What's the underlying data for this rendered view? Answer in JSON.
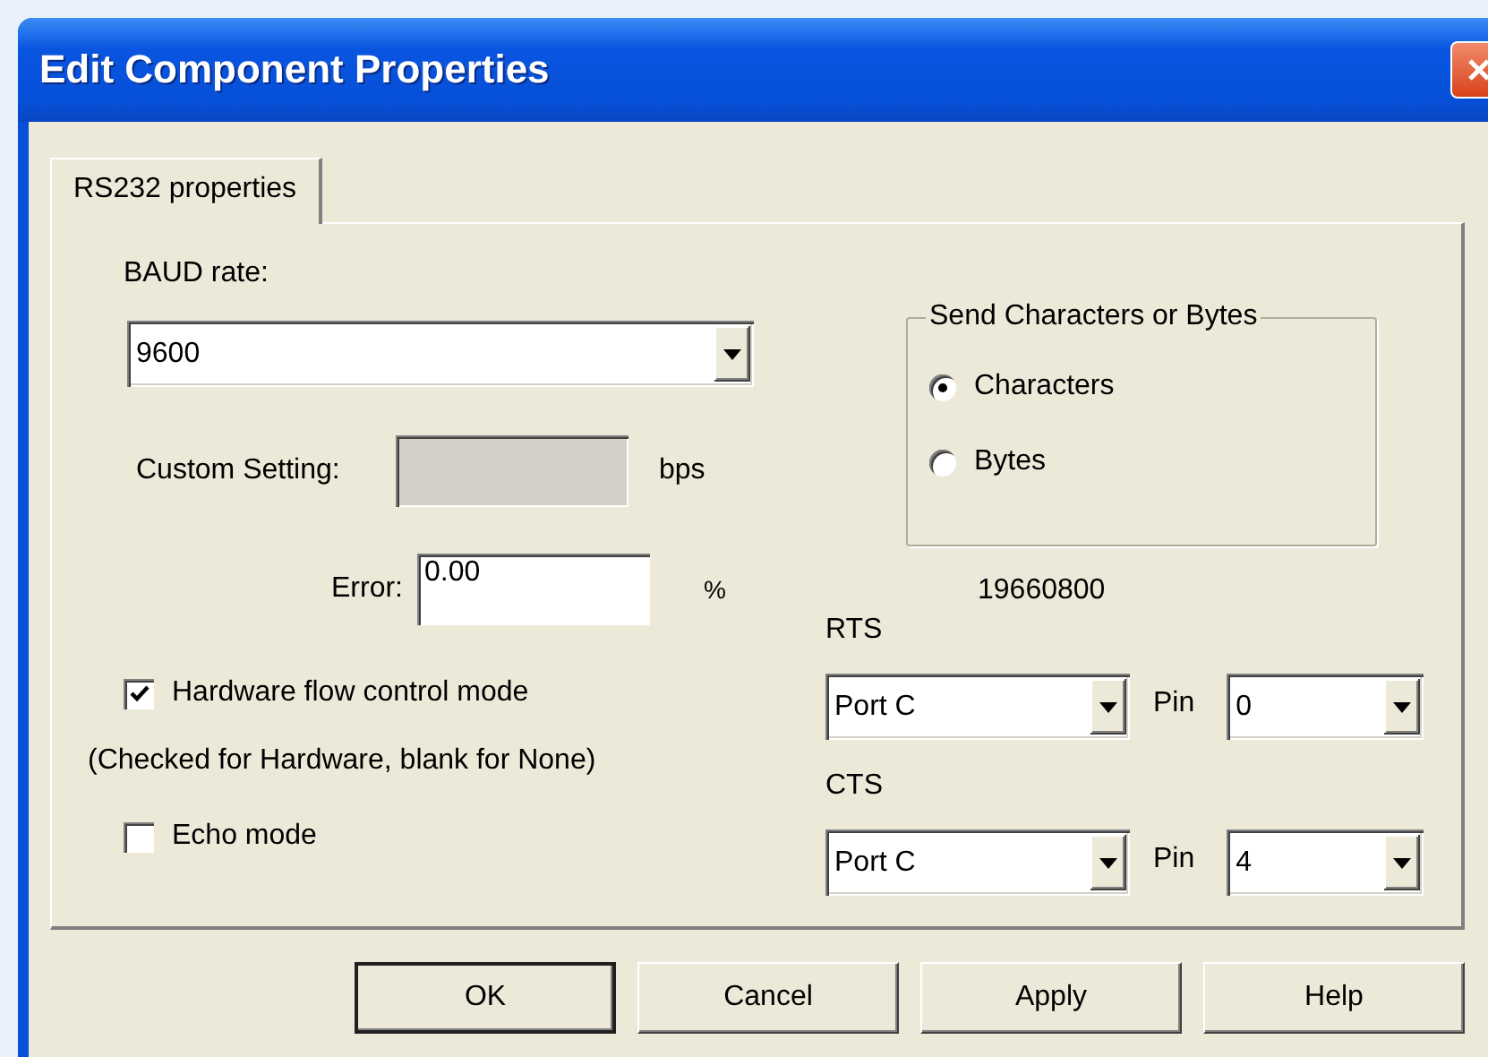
{
  "window": {
    "title": "Edit Component Properties"
  },
  "tabs": [
    {
      "label": "RS232 properties",
      "selected": true
    }
  ],
  "baud_rate": {
    "label": "BAUD rate:",
    "value": "9600"
  },
  "custom_setting": {
    "label": "Custom Setting:",
    "unit": "bps",
    "disabled": true
  },
  "error": {
    "label": "Error:",
    "value": "0.00",
    "unit": "%"
  },
  "send_mode": {
    "title": "Send Characters or Bytes",
    "options": [
      {
        "label": "Characters",
        "selected": true
      },
      {
        "label": "Bytes",
        "selected": false
      }
    ]
  },
  "readout": "19660800",
  "hardware_flow_control": {
    "label": "Hardware flow control mode",
    "checked": true,
    "note": "(Checked for Hardware, blank for None)"
  },
  "echo_mode": {
    "label": "Echo mode",
    "checked": false
  },
  "rts": {
    "label": "RTS",
    "port": "Port C",
    "pin_label": "Pin",
    "pin": "0"
  },
  "cts": {
    "label": "CTS",
    "port": "Port C",
    "pin_label": "Pin",
    "pin": "4"
  },
  "buttons": [
    {
      "label": "OK",
      "default": true
    },
    {
      "label": "Cancel",
      "default": false
    },
    {
      "label": "Apply",
      "default": false
    },
    {
      "label": "Help",
      "default": false
    }
  ]
}
